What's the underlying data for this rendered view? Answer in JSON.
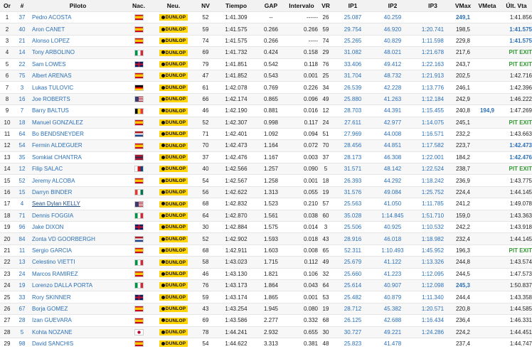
{
  "headers": {
    "pos": "Or",
    "num": "#",
    "rider": "Piloto",
    "nation": "Nac.",
    "tyre": "Neu.",
    "laps": "NV",
    "time": "Tiempo",
    "gap": "GAP",
    "interval": "Intervalo",
    "vr": "VR",
    "ip1": "IP1",
    "ip2": "IP2",
    "ip3": "IP3",
    "vmax": "VMax",
    "vmeta": "VMeta",
    "last": "Últ. Vta"
  },
  "tyre_label": "DUNLOP",
  "flag_colors": {
    "ES": [
      "#c60b1e",
      "#ffc400",
      "#c60b1e"
    ],
    "IT": [
      "#009246",
      "#ffffff",
      "#ce2b37"
    ],
    "GB": [
      "#012169",
      "#ffffff",
      "#c8102e"
    ],
    "DE": [
      "#000000",
      "#dd0000",
      "#ffce00"
    ],
    "US": [
      "#b22234",
      "#ffffff",
      "#3c3b6e"
    ],
    "BE": [
      "#000000",
      "#fdda24",
      "#ef3340"
    ],
    "NL": [
      "#ae1c28",
      "#ffffff",
      "#21468b"
    ],
    "TH": [
      "#a51931",
      "#2d2a4a",
      "#a51931"
    ],
    "CZ": [
      "#ffffff",
      "#d7141a",
      "#11457e"
    ],
    "JP": [
      "#ffffff",
      "#bc002d",
      "#ffffff"
    ]
  },
  "rows": [
    {
      "pos": "1",
      "num": "37",
      "rider": "Pedro ACOSTA",
      "nation": "ES",
      "laps": "52",
      "time": "1:41.309",
      "gap": "--",
      "interval": "------",
      "vr": "26",
      "ip1": "25.087",
      "ip2": "40.259",
      "ip3": "",
      "vmax": "249,1",
      "vmax_best": true,
      "vmeta": "",
      "last": "1:41.856",
      "last_style": ""
    },
    {
      "pos": "2",
      "num": "40",
      "rider": "Aron CANET",
      "nation": "ES",
      "laps": "59",
      "time": "1:41.575",
      "gap": "0.266",
      "interval": "0.266",
      "vr": "59",
      "ip1": "29.754",
      "ip2": "46.920",
      "ip3": "1:20.741",
      "vmax": "198,5",
      "vmax_best": false,
      "vmeta": "",
      "last": "1:41.575",
      "last_style": "best"
    },
    {
      "pos": "3",
      "num": "21",
      "rider": "Alonso LOPEZ",
      "nation": "ES",
      "laps": "74",
      "time": "1:41.575",
      "gap": "0.266",
      "interval": "-----",
      "vr": "74",
      "ip1": "25.265",
      "ip2": "40.829",
      "ip3": "1:11.598",
      "vmax": "229,8",
      "vmax_best": false,
      "vmeta": "",
      "last": "1:41.575",
      "last_style": "best"
    },
    {
      "pos": "4",
      "num": "14",
      "rider": "Tony ARBOLINO",
      "nation": "IT",
      "laps": "69",
      "time": "1:41.732",
      "gap": "0.424",
      "interval": "0.158",
      "vr": "29",
      "ip1": "31.082",
      "ip2": "48.021",
      "ip3": "1:21.678",
      "vmax": "217,6",
      "vmax_best": false,
      "vmeta": "",
      "last": "PIT EXIT",
      "last_style": "pit"
    },
    {
      "pos": "5",
      "num": "22",
      "rider": "Sam LOWES",
      "nation": "GB",
      "laps": "79",
      "time": "1:41.851",
      "gap": "0.542",
      "interval": "0.118",
      "vr": "76",
      "ip1": "33.406",
      "ip2": "49.412",
      "ip3": "1:22.163",
      "vmax": "243,7",
      "vmax_best": false,
      "vmeta": "",
      "last": "PIT EXIT",
      "last_style": "pit"
    },
    {
      "pos": "6",
      "num": "75",
      "rider": "Albert ARENAS",
      "nation": "ES",
      "laps": "47",
      "time": "1:41.852",
      "gap": "0.543",
      "interval": "0.001",
      "vr": "25",
      "ip1": "31.704",
      "ip2": "48.732",
      "ip3": "1:21.913",
      "vmax": "202,5",
      "vmax_best": false,
      "vmeta": "",
      "last": "1:42.716",
      "last_style": ""
    },
    {
      "pos": "7",
      "num": "3",
      "rider": "Lukas TULOVIC",
      "nation": "DE",
      "laps": "61",
      "time": "1:42.078",
      "gap": "0.769",
      "interval": "0.226",
      "vr": "34",
      "ip1": "26.539",
      "ip2": "42.228",
      "ip3": "1:13.776",
      "vmax": "246,1",
      "vmax_best": false,
      "vmeta": "",
      "last": "1:42.396",
      "last_style": ""
    },
    {
      "pos": "8",
      "num": "16",
      "rider": "Joe ROBERTS",
      "nation": "US",
      "laps": "66",
      "time": "1:42.174",
      "gap": "0.865",
      "interval": "0.096",
      "vr": "49",
      "ip1": "25.880",
      "ip2": "41.263",
      "ip3": "1:12.184",
      "vmax": "242,9",
      "vmax_best": false,
      "vmeta": "",
      "last": "1:46.222",
      "last_style": ""
    },
    {
      "pos": "9",
      "num": "7",
      "rider": "Barry BALTUS",
      "nation": "BE",
      "laps": "46",
      "time": "1:42.190",
      "gap": "0.881",
      "interval": "0.016",
      "vr": "12",
      "ip1": "28.703",
      "ip2": "44.391",
      "ip3": "1:15.455",
      "vmax": "240,8",
      "vmax_best": false,
      "vmeta": "194,9",
      "last": "1:47.269",
      "last_style": ""
    },
    {
      "pos": "10",
      "num": "18",
      "rider": "Manuel GONZALEZ",
      "nation": "ES",
      "laps": "52",
      "time": "1:42.307",
      "gap": "0.998",
      "interval": "0.117",
      "vr": "24",
      "ip1": "27.611",
      "ip2": "42.977",
      "ip3": "1:14.075",
      "vmax": "245,1",
      "vmax_best": false,
      "vmeta": "",
      "last": "PIT EXIT",
      "last_style": "pit"
    },
    {
      "pos": "11",
      "num": "64",
      "rider": "Bo BENDSNEYDER",
      "nation": "NL",
      "laps": "71",
      "time": "1:42.401",
      "gap": "1.092",
      "interval": "0.094",
      "vr": "51",
      "ip1": "27.969",
      "ip2": "44.008",
      "ip3": "1:16.571",
      "vmax": "232,2",
      "vmax_best": false,
      "vmeta": "",
      "last": "1:43.663",
      "last_style": ""
    },
    {
      "pos": "12",
      "num": "54",
      "rider": "Fermin ALDEGUER",
      "nation": "ES",
      "laps": "70",
      "time": "1:42.473",
      "gap": "1.164",
      "interval": "0.072",
      "vr": "70",
      "ip1": "28.456",
      "ip2": "44.851",
      "ip3": "1:17.582",
      "vmax": "223,7",
      "vmax_best": false,
      "vmeta": "",
      "last": "1:42.473",
      "last_style": "best"
    },
    {
      "pos": "13",
      "num": "35",
      "rider": "Somkiat CHANTRA",
      "nation": "TH",
      "laps": "37",
      "time": "1:42.476",
      "gap": "1.167",
      "interval": "0.003",
      "vr": "37",
      "ip1": "28.173",
      "ip2": "46.308",
      "ip3": "1:22.001",
      "vmax": "184,2",
      "vmax_best": false,
      "vmeta": "",
      "last": "1:42.476",
      "last_style": "best"
    },
    {
      "pos": "14",
      "num": "12",
      "rider": "Filip SALAC",
      "nation": "CZ",
      "laps": "40",
      "time": "1:42.566",
      "gap": "1.257",
      "interval": "0.090",
      "vr": "5",
      "ip1": "31.571",
      "ip2": "48.142",
      "ip3": "1:22.524",
      "vmax": "238,7",
      "vmax_best": false,
      "vmeta": "",
      "last": "PIT EXIT",
      "last_style": "pit"
    },
    {
      "pos": "15",
      "num": "52",
      "rider": "Jeremy ALCOBA",
      "nation": "ES",
      "laps": "54",
      "time": "1:42.567",
      "gap": "1.258",
      "interval": "0.001",
      "vr": "18",
      "ip1": "26.393",
      "ip2": "44.292",
      "ip3": "1:18.242",
      "vmax": "236,9",
      "vmax_best": false,
      "vmeta": "",
      "last": "1:43.775",
      "last_style": ""
    },
    {
      "pos": "16",
      "num": "15",
      "rider": "Darryn BINDER",
      "nation": "ZA",
      "laps": "56",
      "time": "1:42.622",
      "gap": "1.313",
      "interval": "0.055",
      "vr": "19",
      "ip1": "31.576",
      "ip2": "49.084",
      "ip3": "1:25.752",
      "vmax": "224,4",
      "vmax_best": false,
      "vmeta": "",
      "last": "1:44.145",
      "last_style": ""
    },
    {
      "pos": "17",
      "num": "4",
      "rider": "Sean Dylan KELLY",
      "nation": "US",
      "laps": "68",
      "time": "1:42.832",
      "gap": "1.523",
      "interval": "0.210",
      "vr": "57",
      "ip1": "25.563",
      "ip2": "41.050",
      "ip3": "1:11.785",
      "vmax": "241,2",
      "vmax_best": false,
      "vmeta": "",
      "last": "1:49.078",
      "last_style": "",
      "underline": true
    },
    {
      "pos": "18",
      "num": "71",
      "rider": "Dennis FOGGIA",
      "nation": "IT",
      "laps": "64",
      "time": "1:42.870",
      "gap": "1.561",
      "interval": "0.038",
      "vr": "60",
      "ip1": "35.028",
      "ip2": "1:14.845",
      "ip3": "1:51.710",
      "vmax": "159,0",
      "vmax_best": false,
      "vmeta": "",
      "last": "1:43.363",
      "last_style": ""
    },
    {
      "pos": "19",
      "num": "96",
      "rider": "Jake DIXON",
      "nation": "GB",
      "laps": "30",
      "time": "1:42.884",
      "gap": "1.575",
      "interval": "0.014",
      "vr": "3",
      "ip1": "25.506",
      "ip2": "40.925",
      "ip3": "1:10.532",
      "vmax": "242,2",
      "vmax_best": false,
      "vmeta": "",
      "last": "1:43.918",
      "last_style": ""
    },
    {
      "pos": "20",
      "num": "84",
      "rider": "Zonta VD GOORBERGH",
      "nation": "NL",
      "laps": "52",
      "time": "1:42.902",
      "gap": "1.593",
      "interval": "0.018",
      "vr": "43",
      "ip1": "28.916",
      "ip2": "46.018",
      "ip3": "1:18.982",
      "vmax": "232,4",
      "vmax_best": false,
      "vmeta": "",
      "last": "1:44.145",
      "last_style": ""
    },
    {
      "pos": "21",
      "num": "11",
      "rider": "Sergio GARCIA",
      "nation": "ES",
      "laps": "68",
      "time": "1:42.911",
      "gap": "1.603",
      "interval": "0.008",
      "vr": "65",
      "ip1": "52.311",
      "ip2": "1:10.493",
      "ip3": "1:45.952",
      "vmax": "196,3",
      "vmax_best": false,
      "vmeta": "",
      "last": "PIT EXIT",
      "last_style": "pit"
    },
    {
      "pos": "22",
      "num": "13",
      "rider": "Celestino VIETTI",
      "nation": "IT",
      "laps": "58",
      "time": "1:43.023",
      "gap": "1.715",
      "interval": "0.112",
      "vr": "49",
      "ip1": "25.679",
      "ip2": "41.122",
      "ip3": "1:13.326",
      "vmax": "244,8",
      "vmax_best": false,
      "vmeta": "",
      "last": "1:43.574",
      "last_style": ""
    },
    {
      "pos": "23",
      "num": "24",
      "rider": "Marcos RAMIREZ",
      "nation": "ES",
      "laps": "46",
      "time": "1:43.130",
      "gap": "1.821",
      "interval": "0.106",
      "vr": "32",
      "ip1": "25.660",
      "ip2": "41.223",
      "ip3": "1:12.095",
      "vmax": "244,5",
      "vmax_best": false,
      "vmeta": "",
      "last": "1:47.573",
      "last_style": ""
    },
    {
      "pos": "24",
      "num": "19",
      "rider": "Lorenzo DALLA PORTA",
      "nation": "IT",
      "laps": "76",
      "time": "1:43.173",
      "gap": "1.864",
      "interval": "0.043",
      "vr": "64",
      "ip1": "25.614",
      "ip2": "40.907",
      "ip3": "1:12.098",
      "vmax": "245,3",
      "vmax_best": true,
      "vmeta": "",
      "last": "1:50.837",
      "last_style": ""
    },
    {
      "pos": "25",
      "num": "33",
      "rider": "Rory SKINNER",
      "nation": "GB",
      "laps": "59",
      "time": "1:43.174",
      "gap": "1.865",
      "interval": "0.001",
      "vr": "53",
      "ip1": "25.482",
      "ip2": "40.879",
      "ip3": "1:11.340",
      "vmax": "244,4",
      "vmax_best": false,
      "vmeta": "",
      "last": "1:43.358",
      "last_style": ""
    },
    {
      "pos": "26",
      "num": "67",
      "rider": "Borja GOMEZ",
      "nation": "ES",
      "laps": "43",
      "time": "1:43.254",
      "gap": "1.945",
      "interval": "0.080",
      "vr": "19",
      "ip1": "28.712",
      "ip2": "45.382",
      "ip3": "1:20.571",
      "vmax": "220,8",
      "vmax_best": false,
      "vmeta": "",
      "last": "1:44.585",
      "last_style": ""
    },
    {
      "pos": "27",
      "num": "28",
      "rider": "Izan GUEVARA",
      "nation": "ES",
      "laps": "69",
      "time": "1:43.586",
      "gap": "2.277",
      "interval": "0.332",
      "vr": "68",
      "ip1": "26.125",
      "ip2": "42.688",
      "ip3": "1:16.434",
      "vmax": "236,4",
      "vmax_best": false,
      "vmeta": "",
      "last": "1:46.331",
      "last_style": ""
    },
    {
      "pos": "28",
      "num": "5",
      "rider": "Kohta NOZANE",
      "nation": "JP",
      "laps": "78",
      "time": "1:44.241",
      "gap": "2.932",
      "interval": "0.655",
      "vr": "30",
      "ip1": "30.727",
      "ip2": "49.221",
      "ip3": "1:24.286",
      "vmax": "224,2",
      "vmax_best": false,
      "vmeta": "",
      "last": "1:44.451",
      "last_style": ""
    },
    {
      "pos": "29",
      "num": "98",
      "rider": "David SANCHIS",
      "nation": "ES",
      "laps": "54",
      "time": "1:44.622",
      "gap": "3.313",
      "interval": "0.381",
      "vr": "48",
      "ip1": "25.823",
      "ip2": "41.478",
      "ip3": "",
      "vmax": "237,4",
      "vmax_best": false,
      "vmeta": "",
      "last": "1:44.747",
      "last_style": ""
    }
  ]
}
